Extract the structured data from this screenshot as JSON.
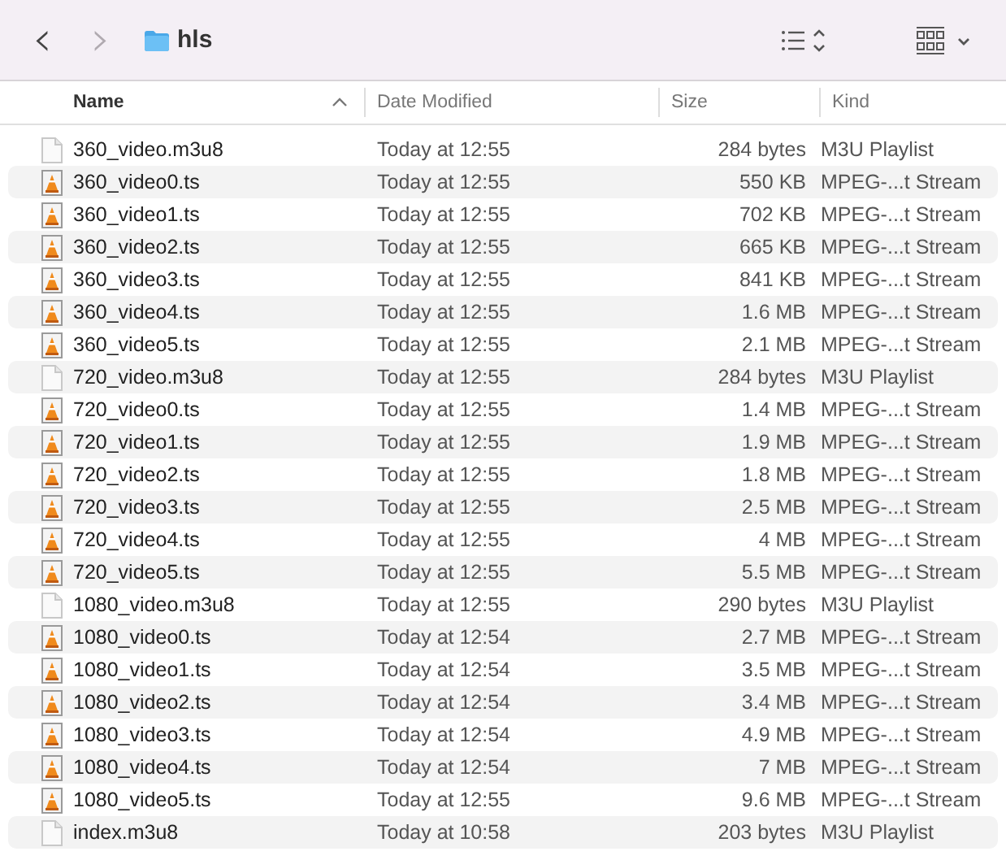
{
  "toolbar": {
    "back": {
      "label": "‹",
      "disabled": false
    },
    "forward": {
      "label": "›",
      "disabled": true
    },
    "title": "hls"
  },
  "columns": [
    {
      "label": "Name",
      "sorted": true
    },
    {
      "label": "Date Modified",
      "sorted": false
    },
    {
      "label": "Size",
      "sorted": false
    },
    {
      "label": "Kind",
      "sorted": false
    }
  ],
  "rows": [
    {
      "kind": "playlist",
      "name": "360_video.m3u8",
      "date": "Today at 12:55",
      "size": "284 bytes",
      "type": "M3U Playlist"
    },
    {
      "kind": "video",
      "name": "360_video0.ts",
      "date": "Today at 12:55",
      "size": "550 KB",
      "type": "MPEG-...t Stream"
    },
    {
      "kind": "video",
      "name": "360_video1.ts",
      "date": "Today at 12:55",
      "size": "702 KB",
      "type": "MPEG-...t Stream"
    },
    {
      "kind": "video",
      "name": "360_video2.ts",
      "date": "Today at 12:55",
      "size": "665 KB",
      "type": "MPEG-...t Stream"
    },
    {
      "kind": "video",
      "name": "360_video3.ts",
      "date": "Today at 12:55",
      "size": "841 KB",
      "type": "MPEG-...t Stream"
    },
    {
      "kind": "video",
      "name": "360_video4.ts",
      "date": "Today at 12:55",
      "size": "1.6 MB",
      "type": "MPEG-...t Stream"
    },
    {
      "kind": "video",
      "name": "360_video5.ts",
      "date": "Today at 12:55",
      "size": "2.1 MB",
      "type": "MPEG-...t Stream"
    },
    {
      "kind": "playlist",
      "name": "720_video.m3u8",
      "date": "Today at 12:55",
      "size": "284 bytes",
      "type": "M3U Playlist"
    },
    {
      "kind": "video",
      "name": "720_video0.ts",
      "date": "Today at 12:55",
      "size": "1.4 MB",
      "type": "MPEG-...t Stream"
    },
    {
      "kind": "video",
      "name": "720_video1.ts",
      "date": "Today at 12:55",
      "size": "1.9 MB",
      "type": "MPEG-...t Stream"
    },
    {
      "kind": "video",
      "name": "720_video2.ts",
      "date": "Today at 12:55",
      "size": "1.8 MB",
      "type": "MPEG-...t Stream"
    },
    {
      "kind": "video",
      "name": "720_video3.ts",
      "date": "Today at 12:55",
      "size": "2.5 MB",
      "type": "MPEG-...t Stream"
    },
    {
      "kind": "video",
      "name": "720_video4.ts",
      "date": "Today at 12:55",
      "size": "4 MB",
      "type": "MPEG-...t Stream"
    },
    {
      "kind": "video",
      "name": "720_video5.ts",
      "date": "Today at 12:55",
      "size": "5.5 MB",
      "type": "MPEG-...t Stream"
    },
    {
      "kind": "playlist",
      "name": "1080_video.m3u8",
      "date": "Today at 12:55",
      "size": "290 bytes",
      "type": "M3U Playlist"
    },
    {
      "kind": "video",
      "name": "1080_video0.ts",
      "date": "Today at 12:54",
      "size": "2.7 MB",
      "type": "MPEG-...t Stream"
    },
    {
      "kind": "video",
      "name": "1080_video1.ts",
      "date": "Today at 12:54",
      "size": "3.5 MB",
      "type": "MPEG-...t Stream"
    },
    {
      "kind": "video",
      "name": "1080_video2.ts",
      "date": "Today at 12:54",
      "size": "3.4 MB",
      "type": "MPEG-...t Stream"
    },
    {
      "kind": "video",
      "name": "1080_video3.ts",
      "date": "Today at 12:54",
      "size": "4.9 MB",
      "type": "MPEG-...t Stream"
    },
    {
      "kind": "video",
      "name": "1080_video4.ts",
      "date": "Today at 12:54",
      "size": "7 MB",
      "type": "MPEG-...t Stream"
    },
    {
      "kind": "video",
      "name": "1080_video5.ts",
      "date": "Today at 12:55",
      "size": "9.6 MB",
      "type": "MPEG-...t Stream"
    },
    {
      "kind": "playlist",
      "name": "index.m3u8",
      "date": "Today at 10:58",
      "size": "203 bytes",
      "type": "M3U Playlist"
    }
  ]
}
